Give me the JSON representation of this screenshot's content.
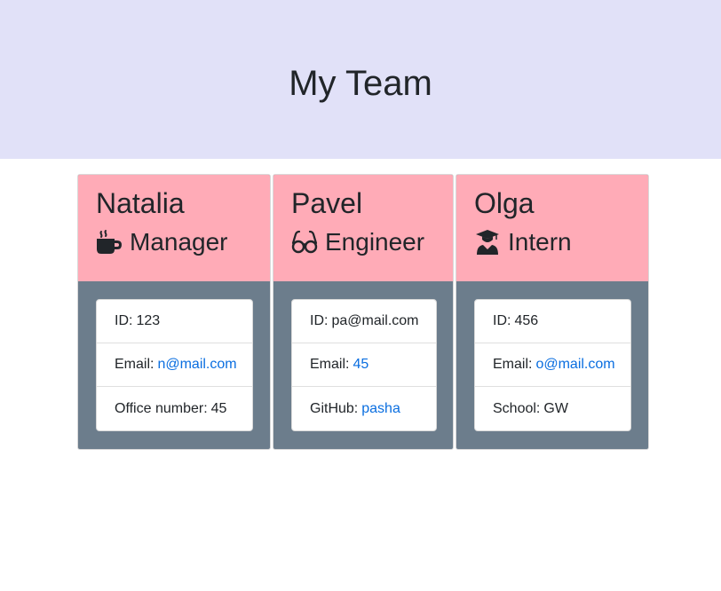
{
  "header": {
    "title": "My Team"
  },
  "colors": {
    "header_bg": "#e1e1f8",
    "card_header_bg": "#ffabb7",
    "card_body_bg": "#6c7d8c",
    "link": "#0a6ee0"
  },
  "cards": [
    {
      "name": "Natalia",
      "role": "Manager",
      "role_icon": "coffee-mug-icon",
      "items": [
        {
          "label": "ID:",
          "value": "123",
          "is_link": false
        },
        {
          "label": "Email:",
          "value": "n@mail.com",
          "is_link": true
        },
        {
          "label": "Office number:",
          "value": "45",
          "is_link": false
        }
      ]
    },
    {
      "name": "Pavel",
      "role": "Engineer",
      "role_icon": "glasses-icon",
      "items": [
        {
          "label": "ID:",
          "value": "pa@mail.com",
          "is_link": false
        },
        {
          "label": "Email:",
          "value": "45",
          "is_link": true
        },
        {
          "label": "GitHub:",
          "value": "pasha",
          "is_link": true
        }
      ]
    },
    {
      "name": "Olga",
      "role": "Intern",
      "role_icon": "graduate-icon",
      "items": [
        {
          "label": "ID:",
          "value": "456",
          "is_link": false
        },
        {
          "label": "Email:",
          "value": "o@mail.com",
          "is_link": true
        },
        {
          "label": "School:",
          "value": "GW",
          "is_link": false
        }
      ]
    }
  ]
}
